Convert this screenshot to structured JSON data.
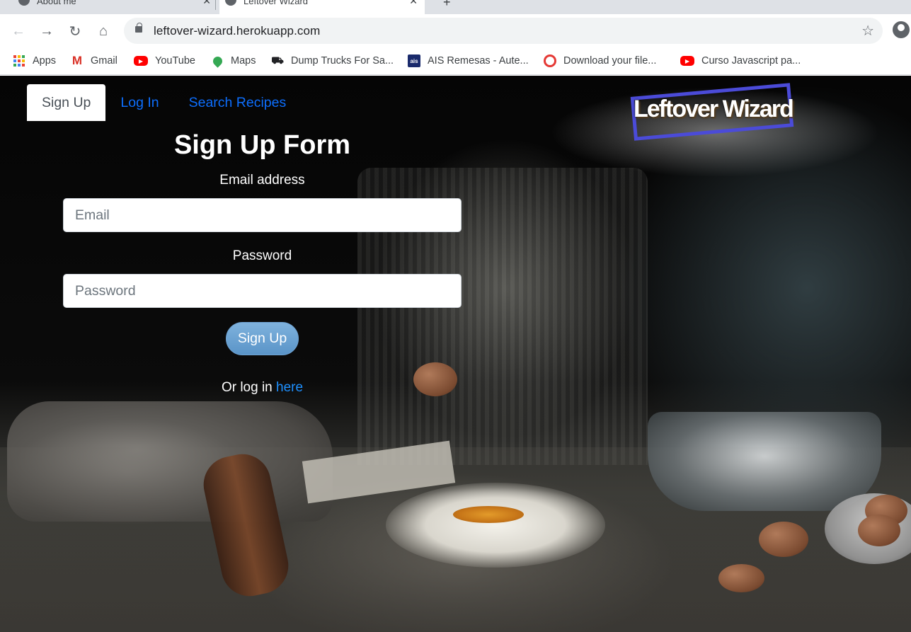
{
  "browser": {
    "tabs": [
      {
        "title": "About me",
        "active": false
      },
      {
        "title": "Leftover Wizard",
        "active": true
      }
    ],
    "url": "leftover-wizard.herokuapp.com",
    "bookmarks": [
      {
        "label": "Apps",
        "icon": "apps-grid-icon"
      },
      {
        "label": "Gmail",
        "icon": "gmail-icon"
      },
      {
        "label": "YouTube",
        "icon": "youtube-icon"
      },
      {
        "label": "Maps",
        "icon": "maps-icon"
      },
      {
        "label": "Dump Trucks For Sa...",
        "icon": "truck-icon"
      },
      {
        "label": "AIS Remesas - Aute...",
        "icon": "ais-icon"
      },
      {
        "label": "Download your file...",
        "icon": "download-icon"
      },
      {
        "label": "Curso Javascript pa...",
        "icon": "youtube-icon"
      }
    ]
  },
  "nav": {
    "tabs": [
      {
        "label": "Sign Up",
        "active": true
      },
      {
        "label": "Log In",
        "active": false
      },
      {
        "label": "Search Recipes",
        "active": false
      }
    ]
  },
  "logo": {
    "text": "Leftover Wizard",
    "border_color": "#4b4bd8"
  },
  "form": {
    "title": "Sign Up Form",
    "email_label": "Email address",
    "email_placeholder": "Email",
    "email_value": "",
    "password_label": "Password",
    "password_placeholder": "Password",
    "password_value": "",
    "submit_label": "Sign Up",
    "login_prompt": "Or log in",
    "login_link": "here"
  },
  "colors": {
    "link": "#0d6efd",
    "button": "#6aa3d5",
    "text": "#ffffff"
  }
}
